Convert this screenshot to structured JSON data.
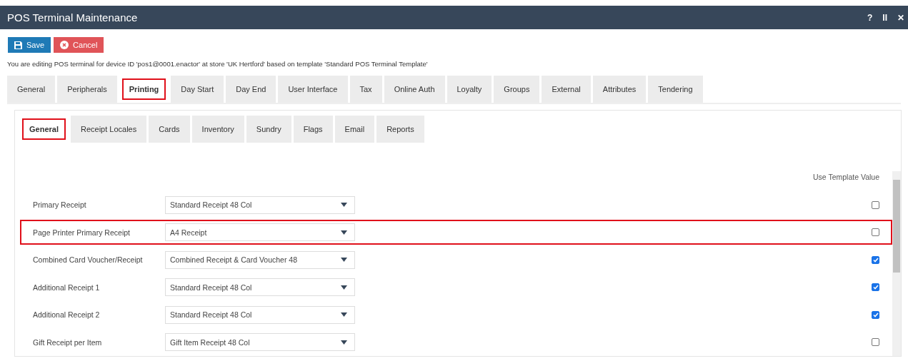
{
  "window": {
    "title": "POS Terminal Maintenance",
    "controls": [
      "?",
      "II",
      "✕"
    ]
  },
  "toolbar": [
    {
      "kind": "save",
      "label": "Save"
    },
    {
      "kind": "cancel",
      "label": "Cancel"
    }
  ],
  "info": "You are editing POS terminal for device ID 'pos1@0001.enactor' at store 'UK Hertford' based on template 'Standard POS Terminal Template'",
  "tabs": [
    {
      "label": "General",
      "selected": false,
      "highlighted": false
    },
    {
      "label": "Peripherals",
      "selected": false,
      "highlighted": false
    },
    {
      "label": "Printing",
      "selected": true,
      "highlighted": true
    },
    {
      "label": "Day Start",
      "selected": false,
      "highlighted": false
    },
    {
      "label": "Day End",
      "selected": false,
      "highlighted": false
    },
    {
      "label": "User Interface",
      "selected": false,
      "highlighted": false
    },
    {
      "label": "Tax",
      "selected": false,
      "highlighted": false
    },
    {
      "label": "Online Auth",
      "selected": false,
      "highlighted": false
    },
    {
      "label": "Loyalty",
      "selected": false,
      "highlighted": false
    },
    {
      "label": "Groups",
      "selected": false,
      "highlighted": false
    },
    {
      "label": "External",
      "selected": false,
      "highlighted": false
    },
    {
      "label": "Attributes",
      "selected": false,
      "highlighted": false
    },
    {
      "label": "Tendering",
      "selected": false,
      "highlighted": false
    }
  ],
  "subtabs": [
    {
      "label": "General",
      "selected": true,
      "highlighted": true
    },
    {
      "label": "Receipt Locales",
      "selected": false,
      "highlighted": false
    },
    {
      "label": "Cards",
      "selected": false,
      "highlighted": false
    },
    {
      "label": "Inventory",
      "selected": false,
      "highlighted": false
    },
    {
      "label": "Sundry",
      "selected": false,
      "highlighted": false
    },
    {
      "label": "Flags",
      "selected": false,
      "highlighted": false
    },
    {
      "label": "Email",
      "selected": false,
      "highlighted": false
    },
    {
      "label": "Reports",
      "selected": false,
      "highlighted": false
    }
  ],
  "column_header": "Use Template Value",
  "rows": [
    {
      "label": "Primary Receipt",
      "value": "Standard Receipt 48 Col",
      "checked": false,
      "highlighted": false
    },
    {
      "label": "Page Printer Primary Receipt",
      "value": "A4 Receipt",
      "checked": false,
      "highlighted": true
    },
    {
      "label": "Combined Card Voucher/Receipt",
      "value": "Combined Receipt & Card Voucher 48",
      "checked": true,
      "highlighted": false
    },
    {
      "label": "Additional Receipt 1",
      "value": "Standard Receipt 48 Col",
      "checked": true,
      "highlighted": false
    },
    {
      "label": "Additional Receipt 2",
      "value": "Standard Receipt 48 Col",
      "checked": true,
      "highlighted": false
    },
    {
      "label": "Gift Receipt per Item",
      "value": "Gift Item Receipt 48 Col",
      "checked": false,
      "highlighted": false
    }
  ]
}
